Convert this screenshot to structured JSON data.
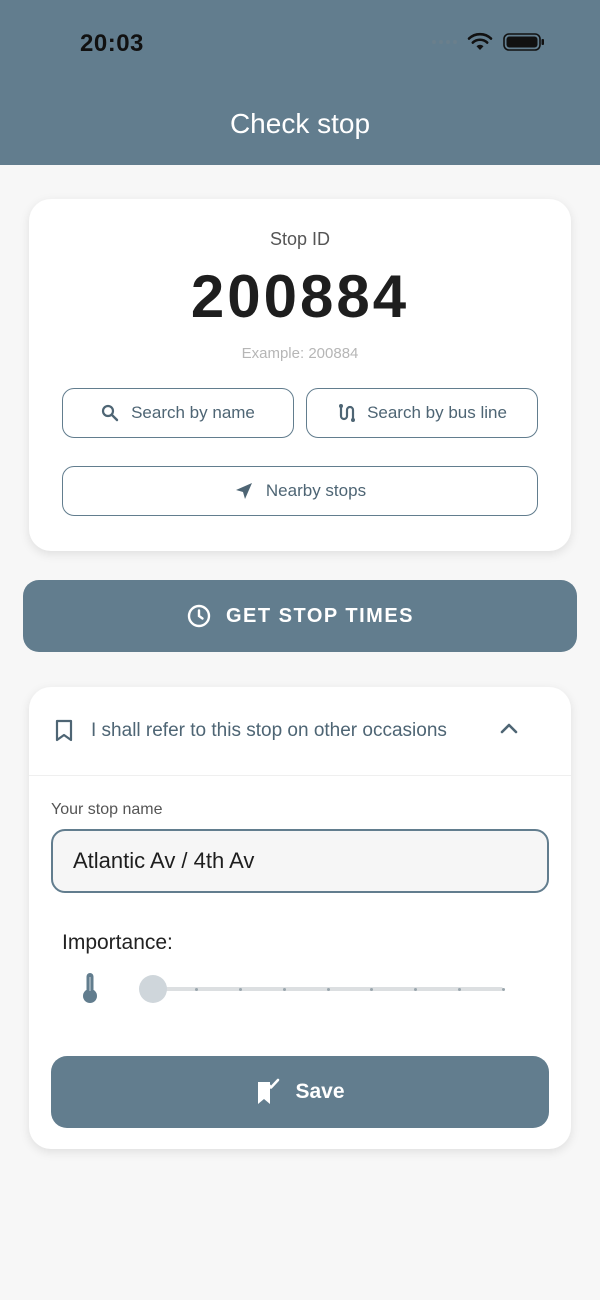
{
  "status_bar": {
    "time": "20:03"
  },
  "header": {
    "title": "Check stop"
  },
  "stop_card": {
    "label": "Stop ID",
    "value": "200884",
    "hint": "Example: 200884",
    "buttons": {
      "search_by_name": "Search by name",
      "search_by_bus_line": "Search by bus line",
      "nearby_stops": "Nearby stops"
    }
  },
  "get_times_button": "GET STOP TIMES",
  "save_section": {
    "accordion_title": "I shall refer to this stop on other occasions",
    "expanded": true,
    "name_label": "Your stop name",
    "name_value": "Atlantic Av / 4th Av",
    "importance_label": "Importance:",
    "importance_level": 0,
    "importance_steps": 9,
    "save_label": "Save"
  },
  "colors": {
    "primary": "#627d8e",
    "background": "#f7f7f7",
    "card": "#ffffff"
  },
  "icons": {
    "search": "search-icon",
    "route": "route-icon",
    "navigation": "navigation-arrow-icon",
    "clock": "clock-icon",
    "bookmark": "bookmark-icon",
    "chevron": "chevron-up-icon",
    "thermometer": "thermometer-icon",
    "save": "bookmark-check-icon"
  }
}
